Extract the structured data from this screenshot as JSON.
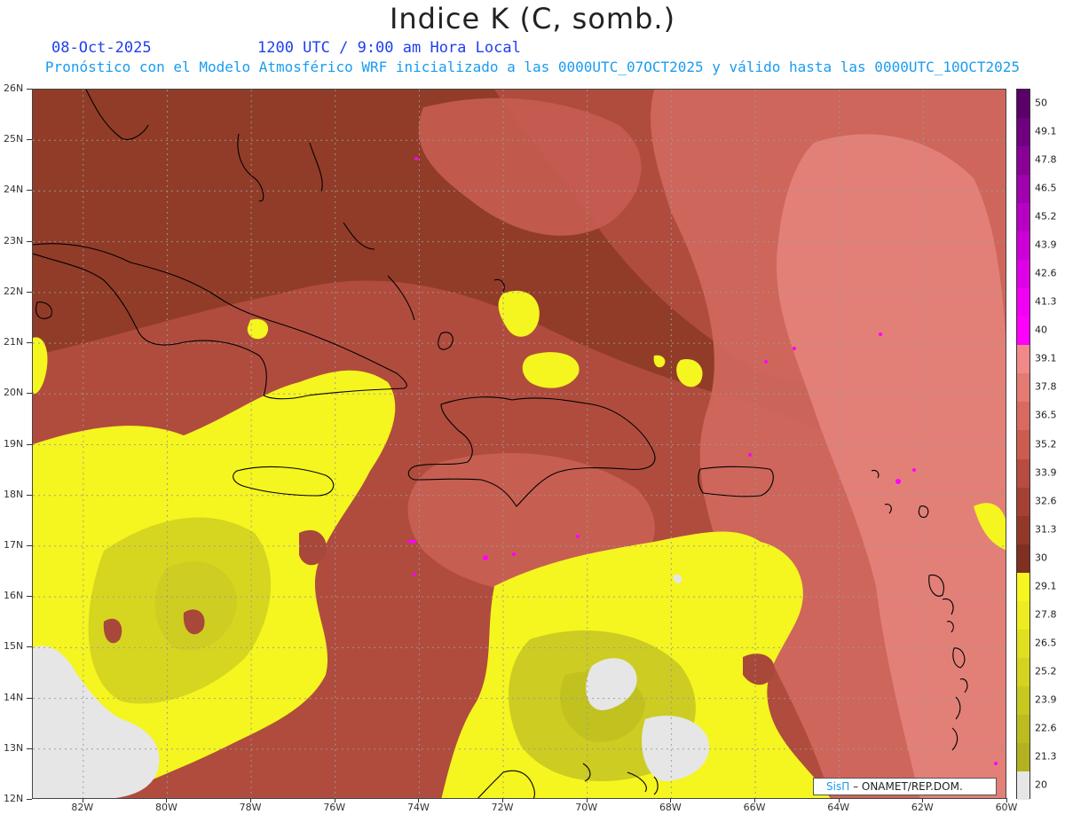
{
  "header": {
    "title": "Indice K (C, somb.)",
    "date": "08-Oct-2025",
    "time": "1200 UTC / 9:00 am Hora Local",
    "description": "Pronóstico con el Modelo Atmosférico WRF inicializado a las 0000UTC_07OCT2025 y válido hasta las  0000UTC_10OCT2025"
  },
  "map": {
    "lat_labels": [
      "26N",
      "25N",
      "24N",
      "23N",
      "22N",
      "21N",
      "20N",
      "19N",
      "18N",
      "17N",
      "16N",
      "15N",
      "14N",
      "13N",
      "12N"
    ],
    "lon_labels": [
      "82W",
      "80W",
      "78W",
      "76W",
      "74W",
      "72W",
      "70W",
      "68W",
      "66W",
      "64W",
      "62W",
      "60W"
    ],
    "lat_range": [
      12,
      26
    ],
    "lon_range": [
      -83.2,
      -60
    ],
    "gridlines": true,
    "colors": {
      "dry": "#e6e6e6",
      "yellow": "#f5f520",
      "olive": "#c8c820",
      "dark_red": "#8c3a24",
      "red": "#a8483a",
      "salmon": "#d26a62",
      "pink": "#e8807a",
      "magenta": "#ff00ff",
      "coastline": "#000000"
    }
  },
  "colorbar": {
    "labels": [
      "50",
      "49.1",
      "47.8",
      "46.5",
      "45.2",
      "43.9",
      "42.6",
      "41.3",
      "40",
      "39.1",
      "37.8",
      "36.5",
      "35.2",
      "33.9",
      "32.6",
      "31.3",
      "30",
      "29.1",
      "27.8",
      "26.5",
      "25.2",
      "23.9",
      "22.6",
      "21.3",
      "20"
    ],
    "colors": [
      "#5a0068",
      "#70007f",
      "#8a0096",
      "#a000ad",
      "#b800c4",
      "#cc00d6",
      "#e000e8",
      "#f200f4",
      "#ff00ff",
      "#f08a88",
      "#e47a72",
      "#d86a60",
      "#cc5c50",
      "#b84c40",
      "#a54034",
      "#92382a",
      "#7f3020",
      "#f5f520",
      "#ecec20",
      "#e0e020",
      "#d4d420",
      "#c8c820",
      "#bcbc20",
      "#b2b220",
      "#e6e6e6"
    ]
  },
  "credit": {
    "brand": "SisΠ",
    "text": "– ONAMET/REP.DOM."
  }
}
